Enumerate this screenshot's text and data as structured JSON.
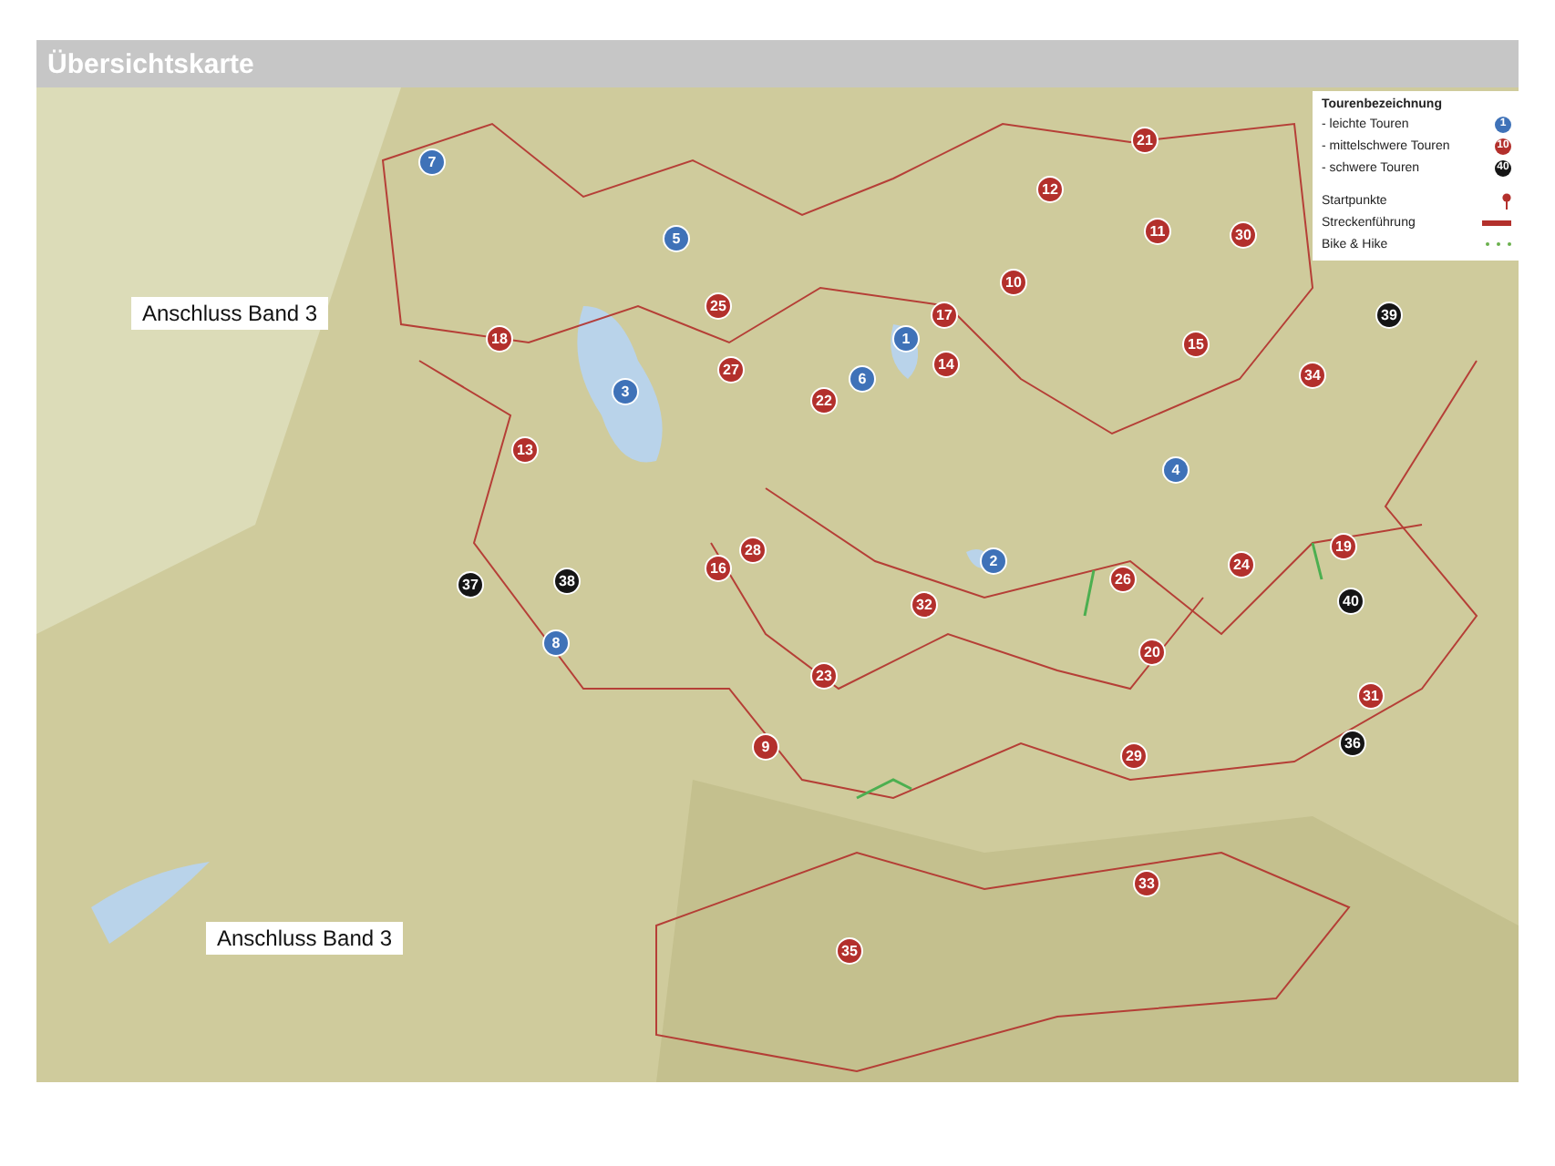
{
  "title": "Übersichtskarte",
  "legend": {
    "title": "Tourenbezeichnung",
    "items": [
      {
        "kind": "marker",
        "label": "- leichte Touren",
        "symbol": "1",
        "color": "#3f72b8"
      },
      {
        "kind": "marker",
        "label": "- mittelschwere Touren",
        "symbol": "10",
        "color": "#b3302c"
      },
      {
        "kind": "marker",
        "label": "- schwere Touren",
        "symbol": "40",
        "color": "#151515"
      },
      {
        "kind": "pin",
        "label": "Startpunkte"
      },
      {
        "kind": "line",
        "label": "Streckenführung"
      },
      {
        "kind": "dots",
        "label": "Bike & Hike"
      }
    ]
  },
  "connections": [
    "Anschluss Band 3",
    "Anschluss Band 3"
  ],
  "tours": [
    {
      "number": "7",
      "color": "#3f72b8"
    },
    {
      "number": "5",
      "color": "#3f72b8"
    },
    {
      "number": "3",
      "color": "#3f72b8"
    },
    {
      "number": "6",
      "color": "#3f72b8"
    },
    {
      "number": "1",
      "color": "#3f72b8"
    },
    {
      "number": "2",
      "color": "#3f72b8"
    },
    {
      "number": "4",
      "color": "#3f72b8"
    },
    {
      "number": "8",
      "color": "#3f72b8"
    },
    {
      "number": "21",
      "color": "#b3302c"
    },
    {
      "number": "12",
      "color": "#b3302c"
    },
    {
      "number": "11",
      "color": "#b3302c"
    },
    {
      "number": "30",
      "color": "#b3302c"
    },
    {
      "number": "10",
      "color": "#b3302c"
    },
    {
      "number": "25",
      "color": "#b3302c"
    },
    {
      "number": "17",
      "color": "#b3302c"
    },
    {
      "number": "15",
      "color": "#b3302c"
    },
    {
      "number": "18",
      "color": "#b3302c"
    },
    {
      "number": "27",
      "color": "#b3302c"
    },
    {
      "number": "14",
      "color": "#b3302c"
    },
    {
      "number": "22",
      "color": "#b3302c"
    },
    {
      "number": "34",
      "color": "#b3302c"
    },
    {
      "number": "13",
      "color": "#b3302c"
    },
    {
      "number": "28",
      "color": "#b3302c"
    },
    {
      "number": "16",
      "color": "#b3302c"
    },
    {
      "number": "26",
      "color": "#b3302c"
    },
    {
      "number": "24",
      "color": "#b3302c"
    },
    {
      "number": "19",
      "color": "#b3302c"
    },
    {
      "number": "32",
      "color": "#b3302c"
    },
    {
      "number": "20",
      "color": "#b3302c"
    },
    {
      "number": "23",
      "color": "#b3302c"
    },
    {
      "number": "31",
      "color": "#b3302c"
    },
    {
      "number": "9",
      "color": "#b3302c"
    },
    {
      "number": "29",
      "color": "#b3302c"
    },
    {
      "number": "33",
      "color": "#b3302c"
    },
    {
      "number": "35",
      "color": "#b3302c"
    },
    {
      "number": "39",
      "color": "#151515"
    },
    {
      "number": "37",
      "color": "#151515"
    },
    {
      "number": "38",
      "color": "#151515"
    },
    {
      "number": "40",
      "color": "#151515"
    },
    {
      "number": "36",
      "color": "#151515"
    }
  ]
}
